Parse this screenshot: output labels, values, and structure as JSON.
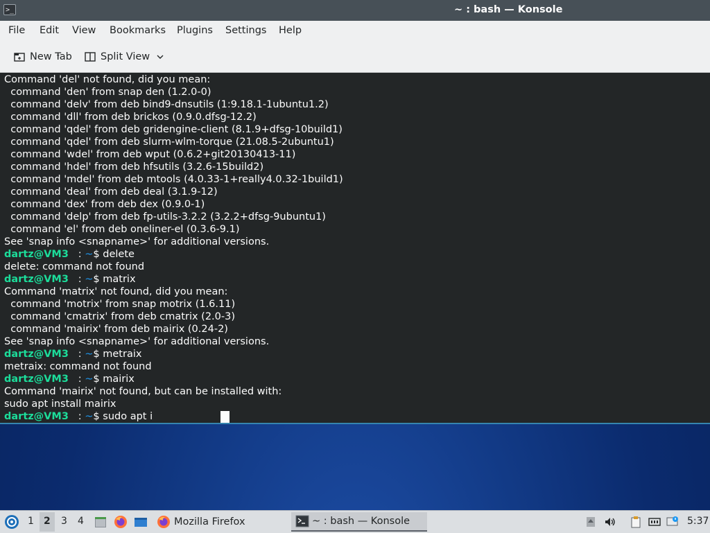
{
  "window": {
    "title": "~ : bash — Konsole",
    "app_icon_glyph": ">_"
  },
  "menubar": [
    "File",
    "Edit",
    "View",
    "Bookmarks",
    "Plugins",
    "Settings",
    "Help"
  ],
  "toolbar": {
    "new_tab": "New Tab",
    "split_view": "Split View",
    "caret": "⌄"
  },
  "terminal": {
    "lines": [
      {
        "type": "text",
        "text": "Command 'del' not found, did you mean:"
      },
      {
        "type": "text",
        "text": "  command 'den' from snap den (1.2.0-0)"
      },
      {
        "type": "text",
        "text": "  command 'delv' from deb bind9-dnsutils (1:9.18.1-1ubuntu1.2)"
      },
      {
        "type": "text",
        "text": "  command 'dll' from deb brickos (0.9.0.dfsg-12.2)"
      },
      {
        "type": "text",
        "text": "  command 'qdel' from deb gridengine-client (8.1.9+dfsg-10build1)"
      },
      {
        "type": "text",
        "text": "  command 'qdel' from deb slurm-wlm-torque (21.08.5-2ubuntu1)"
      },
      {
        "type": "text",
        "text": "  command 'wdel' from deb wput (0.6.2+git20130413-11)"
      },
      {
        "type": "text",
        "text": "  command 'hdel' from deb hfsutils (3.2.6-15build2)"
      },
      {
        "type": "text",
        "text": "  command 'mdel' from deb mtools (4.0.33-1+really4.0.32-1build1)"
      },
      {
        "type": "text",
        "text": "  command 'deal' from deb deal (3.1.9-12)"
      },
      {
        "type": "text",
        "text": "  command 'dex' from deb dex (0.9.0-1)"
      },
      {
        "type": "text",
        "text": "  command 'delp' from deb fp-utils-3.2.2 (3.2.2+dfsg-9ubuntu1)"
      },
      {
        "type": "text",
        "text": "  command 'el' from deb oneliner-el (0.3.6-9.1)"
      },
      {
        "type": "text",
        "text": "See 'snap info <snapname>' for additional versions."
      },
      {
        "type": "prompt",
        "user": "dartz@VM3",
        "sep": "   : ",
        "path": "~",
        "dollar": "$ ",
        "cmd": "delete"
      },
      {
        "type": "text",
        "text": "delete: command not found"
      },
      {
        "type": "prompt",
        "user": "dartz@VM3",
        "sep": "   : ",
        "path": "~",
        "dollar": "$ ",
        "cmd": "matrix"
      },
      {
        "type": "text",
        "text": "Command 'matrix' not found, did you mean:"
      },
      {
        "type": "text",
        "text": "  command 'motrix' from snap motrix (1.6.11)"
      },
      {
        "type": "text",
        "text": "  command 'cmatrix' from deb cmatrix (2.0-3)"
      },
      {
        "type": "text",
        "text": "  command 'mairix' from deb mairix (0.24-2)"
      },
      {
        "type": "text",
        "text": "See 'snap info <snapname>' for additional versions."
      },
      {
        "type": "prompt",
        "user": "dartz@VM3",
        "sep": "   : ",
        "path": "~",
        "dollar": "$ ",
        "cmd": "metraix"
      },
      {
        "type": "text",
        "text": "metraix: command not found"
      },
      {
        "type": "prompt",
        "user": "dartz@VM3",
        "sep": "   : ",
        "path": "~",
        "dollar": "$ ",
        "cmd": "mairix"
      },
      {
        "type": "text",
        "text": "Command 'mairix' not found, but can be installed with:"
      },
      {
        "type": "text",
        "text": "sudo apt install mairix"
      },
      {
        "type": "prompt",
        "user": "dartz@VM3",
        "sep": "   : ",
        "path": "~",
        "dollar": "$ ",
        "cmd": "sudo apt i"
      }
    ]
  },
  "colors": {
    "terminal_bg": "#232627",
    "terminal_fg": "#fcfcfc",
    "prompt_user": "#1cdc9a",
    "prompt_path": "#1d99f3",
    "titlebar_bg": "#475057"
  },
  "taskbar": {
    "desktops": [
      "1",
      "2",
      "3",
      "4"
    ],
    "active_desktop": "2",
    "tasks": [
      {
        "label": "Mozilla Firefox",
        "icon": "firefox-icon",
        "active": false
      },
      {
        "label": "~ : bash — Konsole",
        "icon": "terminal-icon",
        "active": true
      }
    ],
    "clock": "5:37"
  }
}
